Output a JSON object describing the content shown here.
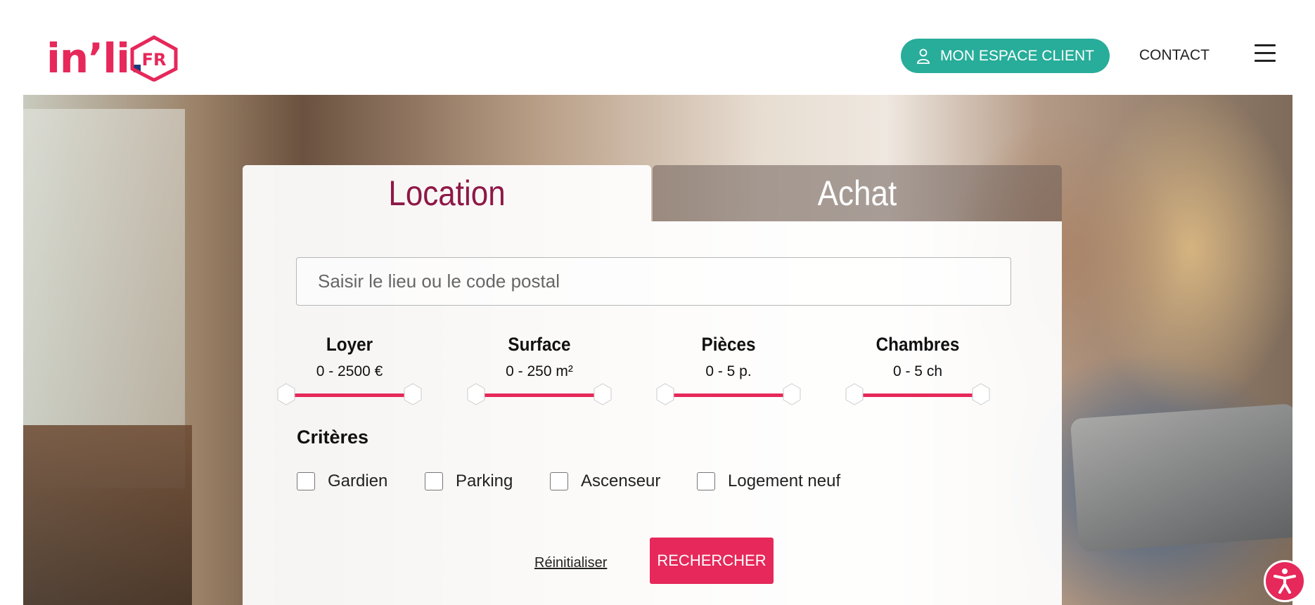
{
  "header": {
    "logo_text": "in’li",
    "logo_dot": ".",
    "logo_badge": "FR",
    "client_button": "MON ESPACE CLIENT",
    "contact": "CONTACT"
  },
  "icons": {
    "client": "user-icon",
    "menu": "hamburger-menu-icon",
    "accessibility": "accessibility-icon"
  },
  "search": {
    "tabs": [
      "Location",
      "Achat"
    ],
    "active_tab": "Location",
    "placeholder": "Saisir le lieu ou le code postal",
    "ranges": [
      {
        "label": "Loyer",
        "value": "0 - 2500 €"
      },
      {
        "label": "Surface",
        "value": "0 - 250 m²"
      },
      {
        "label": "Pièces",
        "value": "0 - 5 p."
      },
      {
        "label": "Chambres",
        "value": "0 - 5 ch"
      }
    ],
    "criteria_title": "Critères",
    "criteria": [
      "Gardien",
      "Parking",
      "Ascenseur",
      "Logement neuf"
    ],
    "reset": "Réinitialiser",
    "submit": "RECHERCHER"
  },
  "colors": {
    "brand_pink": "#e6285a",
    "teal": "#27ad99",
    "location_tab": "#8e1846",
    "logo_navy": "#1d3a78"
  }
}
